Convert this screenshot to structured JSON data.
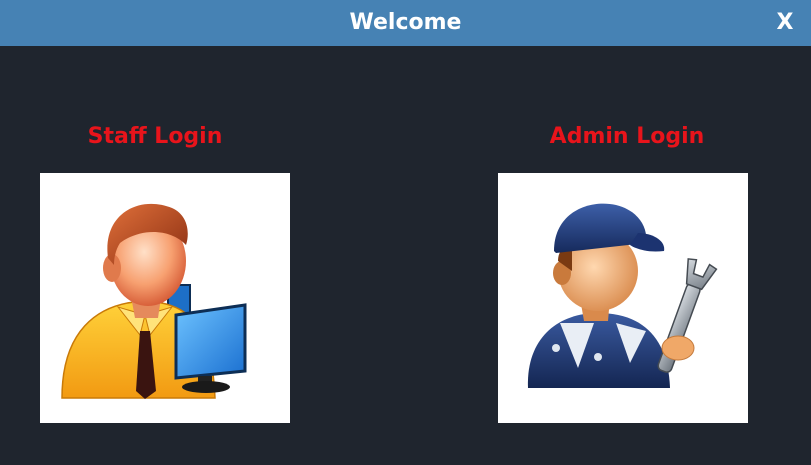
{
  "window": {
    "title": "Welcome",
    "close_label": "X"
  },
  "staff": {
    "label": "Staff Login",
    "icon": "staff-user-computer-icon"
  },
  "admin": {
    "label": "Admin Login",
    "icon": "admin-mechanic-wrench-icon"
  },
  "colors": {
    "titlebar": "#4682b4",
    "background": "#1f252e",
    "label": "#e8141b",
    "tile": "#ffffff"
  }
}
